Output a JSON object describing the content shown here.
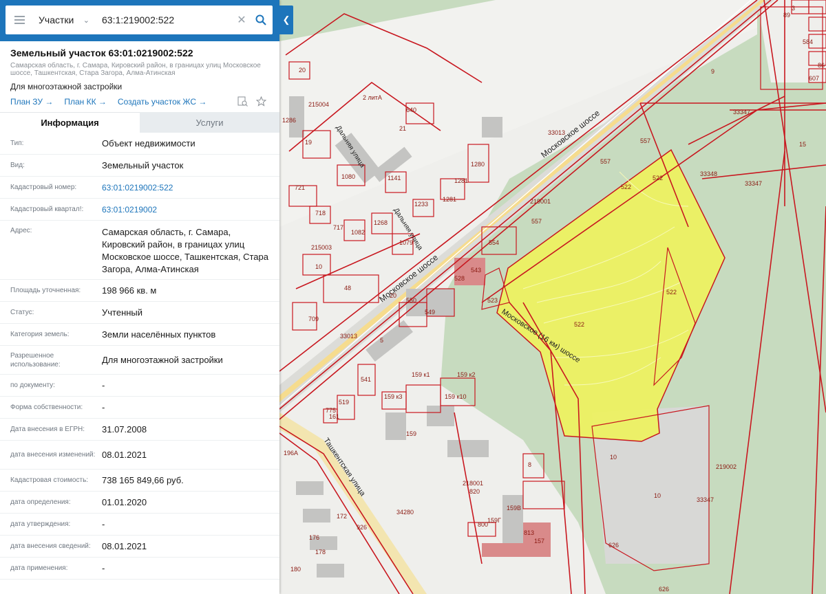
{
  "search": {
    "type_label": "Участки",
    "query": "63:1:219002:522"
  },
  "header": {
    "title": "Земельный участок 63:01:0219002:522",
    "address": "Самарская область, г. Самара, Кировский район, в границах улиц Московское шоссе, Ташкентская, Стара Загора, Алма-Атинская",
    "purpose": "Для многоэтажной застройки",
    "links": [
      "План ЗУ →",
      "План КК →",
      "Создать участок ЖС →"
    ]
  },
  "tabs": [
    "Информация",
    "Услуги"
  ],
  "info_rows": [
    {
      "label": "Тип:",
      "value": "Объект недвижимости"
    },
    {
      "label": "Вид:",
      "value": "Земельный участок"
    },
    {
      "label": "Кадастровый номер:",
      "value": "63:01:0219002:522"
    },
    {
      "label": "Кадастровый квартал!:",
      "value": "63:01:0219002"
    },
    {
      "label": "Адрес:",
      "value": "Самарская область, г. Самара, Кировский район, в границах улиц Московское шоссе, Ташкентская, Стара Загора, Алма-Атинская"
    },
    {
      "label": "Площадь уточненная:",
      "value": "198 966 кв. м"
    },
    {
      "label": "Статус:",
      "value": "Учтенный"
    },
    {
      "label": "Категория земель:",
      "value": "Земли населённых пунктов"
    },
    {
      "label": "Разрешенное использование:",
      "value": "Для многоэтажной застройки"
    },
    {
      "label": "по документу:",
      "value": "-"
    },
    {
      "label": "Форма собственности:",
      "value": "-"
    },
    {
      "label": "Дата внесения в ЕГРН:",
      "value": "31.07.2008"
    },
    {
      "label": "дата внесения изменений:",
      "value": "08.01.2021"
    },
    {
      "label": "Кадастровая стоимость:",
      "value": "738 165 849,66 руб."
    },
    {
      "label": "дата определения:",
      "value": "01.01.2020"
    },
    {
      "label": "дата утверждения:",
      "value": "-"
    },
    {
      "label": "дата внесения сведений:",
      "value": "08.01.2021"
    },
    {
      "label": "дата применения:",
      "value": "-"
    }
  ],
  "map": {
    "street_labels": [
      "Московское шоссе",
      "Московское шоссе",
      "Московское (16 км) шоссе",
      "Дальняя улица",
      "Дальняя улица",
      "Ташкентская улица"
    ],
    "parcel_labels": [
      "522",
      "522",
      "522",
      "522",
      "523",
      "557",
      "557",
      "557",
      "554",
      "549",
      "528",
      "543",
      "550",
      "20",
      "219001",
      "219002",
      "215004",
      "215003",
      "218001",
      "33347",
      "33347",
      "33348",
      "33347",
      "33013",
      "33013",
      "34280",
      "1280",
      "1281",
      "1281",
      "1233",
      "1141",
      "1080",
      "1079",
      "1082",
      "1268",
      "717",
      "718",
      "721",
      "709",
      "48",
      "10",
      "10",
      "10",
      "19",
      "20",
      "21",
      "640",
      "2 литА",
      "1286",
      "541",
      "5",
      "519",
      "775",
      "161",
      "159 к1",
      "159 к2",
      "159 к3",
      "159 к10",
      "159",
      "159В",
      "159Г",
      "813",
      "157",
      "820",
      "800",
      "8",
      "626",
      "626",
      "9",
      "15",
      "89",
      "584",
      "607",
      "196А",
      "172",
      "176",
      "178",
      "180",
      "926",
      "86",
      "3"
    ],
    "colors": {
      "highlight_fill": "#eef25e",
      "boundary": "#c8171f",
      "green": "#c9dcc1",
      "urban": "#f0f0ee"
    }
  }
}
